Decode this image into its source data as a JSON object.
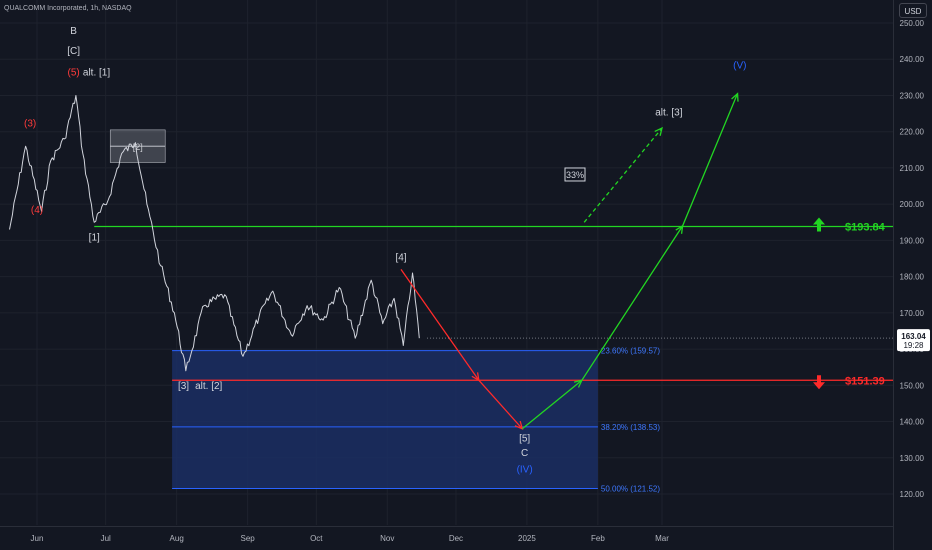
{
  "header": {
    "title": "QUALCOMM Incorporated, 1h, NASDAQ"
  },
  "price_axis": {
    "currency": "USD",
    "current_price": "163.04",
    "countdown": "19:28"
  },
  "colors": {
    "background": "#131722",
    "grid": "#1e222d",
    "price_line": "#d1d4dc",
    "green": "#22d622",
    "red": "#ff2a2a",
    "fib_zone": "#1b2e63",
    "fib_line": "#2962ff",
    "fib_label": "#3e78ff",
    "wave_red": "#ff3b3b",
    "wave_white": "#d1d4dc",
    "wave_blue": "#2962ff"
  },
  "chart_data": {
    "type": "line",
    "title": "QUALCOMM Incorporated, 1h, NASDAQ",
    "ylim": [
      115,
      255
    ],
    "yticks": [
      120,
      130,
      140,
      150,
      160,
      170,
      180,
      190,
      200,
      210,
      220,
      230,
      240,
      250
    ],
    "ytick_labels": [
      "120.00",
      "130.00",
      "140.00",
      "150.00",
      "160.00",
      "170.00",
      "180.00",
      "190.00",
      "200.00",
      "210.00",
      "220.00",
      "230.00",
      "240.00",
      "250.00"
    ],
    "xticks": [
      "Jun",
      "Jul",
      "Aug",
      "Sep",
      "Oct",
      "Nov",
      "Dec",
      "2025",
      "Feb",
      "Mar"
    ],
    "grid": true,
    "series": [
      {
        "x": [
          "2024-05-20",
          "2024-05-27",
          "2024-06-03",
          "2024-06-07",
          "2024-06-13",
          "2024-06-18",
          "2024-06-21",
          "2024-06-26",
          "2024-07-02",
          "2024-07-08",
          "2024-07-14",
          "2024-07-19",
          "2024-07-25",
          "2024-07-31",
          "2024-08-05",
          "2024-08-13",
          "2024-08-22",
          "2024-08-30",
          "2024-09-06",
          "2024-09-12",
          "2024-09-20",
          "2024-09-27",
          "2024-10-04",
          "2024-10-11",
          "2024-10-18",
          "2024-10-25",
          "2024-10-30",
          "2024-11-04",
          "2024-11-08",
          "2024-11-12",
          "2024-11-15"
        ],
        "values": [
          193,
          216,
          198,
          212,
          218,
          230,
          214,
          195,
          201,
          214,
          217,
          200,
          183,
          170,
          154,
          172,
          175,
          158,
          169,
          176,
          164,
          172,
          168,
          177,
          163,
          179,
          167,
          174,
          161,
          181,
          163
        ]
      }
    ],
    "levels": [
      {
        "price": 193.84,
        "label": "$193.84",
        "color": "green",
        "arrow": "up"
      },
      {
        "price": 151.39,
        "label": "$151.39",
        "color": "red",
        "arrow": "down"
      }
    ],
    "fib_zone": {
      "top": 159.57,
      "bottom": 121.52,
      "x_start": "2024-07-30",
      "x_end": "2025-02-01",
      "levels": [
        {
          "price": 159.57,
          "label": "23.60% (159.57)"
        },
        {
          "price": 138.53,
          "label": "38.20% (138.53)"
        },
        {
          "price": 121.52,
          "label": "50.00% (121.52)"
        }
      ]
    },
    "projections": [
      {
        "style": "solid",
        "color": "red",
        "points": [
          [
            "2024-11-07",
            182
          ],
          [
            "2024-12-11",
            151.4
          ],
          [
            "2024-12-30",
            138
          ]
        ]
      },
      {
        "style": "solid",
        "color": "green",
        "points": [
          [
            "2024-12-30",
            138
          ],
          [
            "2025-01-25",
            151.4
          ],
          [
            "2025-03-10",
            194
          ],
          [
            "2025-04-03",
            230.5
          ]
        ]
      },
      {
        "style": "dashed",
        "color": "green",
        "points": [
          [
            "2025-01-26",
            195
          ],
          [
            "2025-03-01",
            221
          ]
        ]
      }
    ],
    "box": {
      "x_start": "2024-07-03",
      "x_end": "2024-07-27",
      "top": 220.5,
      "bottom": 211.5,
      "label": "[2]"
    },
    "annotations": [
      {
        "text": "B",
        "x": "2024-06-17",
        "y": 247,
        "color": "wave_white"
      },
      {
        "text": "[C]",
        "x": "2024-06-17",
        "y": 241.5,
        "color": "wave_white"
      },
      {
        "text": "(5)",
        "x": "2024-06-17",
        "y": 235.5,
        "color": "wave_red"
      },
      {
        "text": "alt. [1]",
        "x": "2024-06-27",
        "y": 235.5,
        "color": "wave_white"
      },
      {
        "text": "(3)",
        "x": "2024-05-29",
        "y": 221.5,
        "color": "wave_red"
      },
      {
        "text": "(4)",
        "x": "2024-06-01",
        "y": 197.5,
        "color": "wave_red"
      },
      {
        "text": "[1]",
        "x": "2024-06-26",
        "y": 190,
        "color": "wave_white"
      },
      {
        "text": "[3]",
        "x": "2024-08-04",
        "y": 149,
        "color": "wave_white"
      },
      {
        "text": "alt. [2]",
        "x": "2024-08-15",
        "y": 149,
        "color": "wave_white"
      },
      {
        "text": "[4]",
        "x": "2024-11-07",
        "y": 184.5,
        "color": "wave_white"
      },
      {
        "text": "[5]",
        "x": "2024-12-31",
        "y": 134.5,
        "color": "wave_white"
      },
      {
        "text": "C",
        "x": "2024-12-31",
        "y": 130.5,
        "color": "wave_white"
      },
      {
        "text": "(IV)",
        "x": "2024-12-31",
        "y": 126,
        "color": "wave_blue"
      },
      {
        "text": "alt. [3]",
        "x": "2025-03-04",
        "y": 224.5,
        "color": "wave_white"
      },
      {
        "text": "(V)",
        "x": "2025-04-04",
        "y": 237.5,
        "color": "wave_blue"
      },
      {
        "text": "33%",
        "x": "2025-01-22",
        "y": 207.5,
        "color": "wave_white",
        "boxed": true
      }
    ]
  }
}
